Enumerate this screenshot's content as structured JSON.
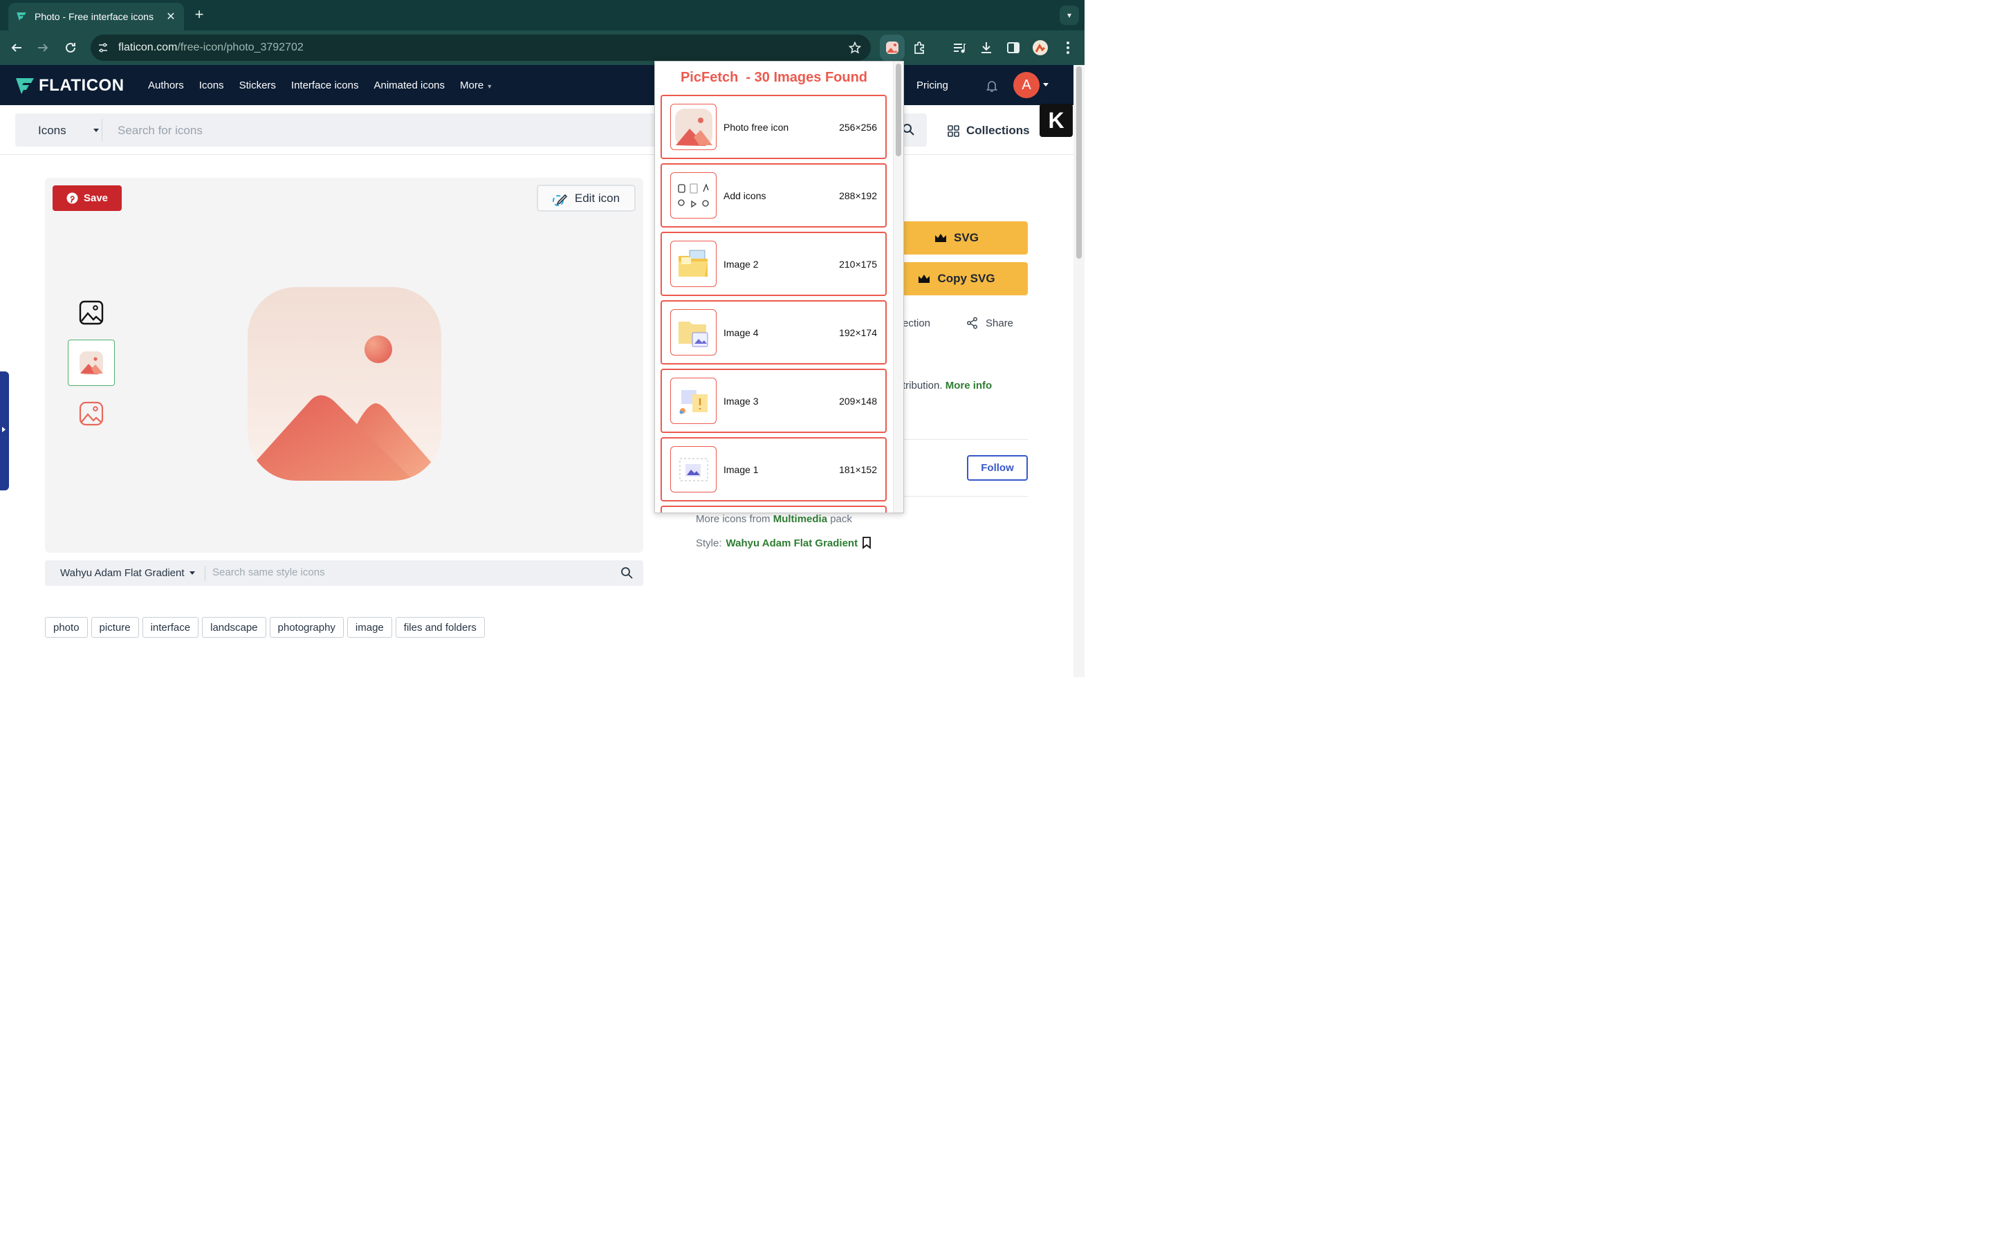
{
  "browser": {
    "tab_title": "Photo - Free interface icons",
    "url_host": "flaticon.com",
    "url_path": "/free-icon/photo_3792702"
  },
  "header": {
    "logo": "FLATICON",
    "nav": [
      "Authors",
      "Icons",
      "Stickers",
      "Interface icons",
      "Animated icons",
      "More"
    ],
    "pricing": "Pricing",
    "avatar_letter": "A"
  },
  "search": {
    "type": "Icons",
    "placeholder": "Search for icons",
    "collections": "Collections"
  },
  "preview": {
    "save_label": "Save",
    "edit_label": "Edit icon"
  },
  "style_search": {
    "style_name": "Wahyu Adam Flat Gradient",
    "placeholder": "Search same style icons"
  },
  "tags": [
    "photo",
    "picture",
    "interface",
    "landscape",
    "photography",
    "image",
    "files and folders"
  ],
  "sidebar": {
    "svg_label": "SVG",
    "copy_svg_label": "Copy SVG",
    "collection_fragment": "ection",
    "share_label": "Share",
    "attribution_text": "tribution.",
    "more_info": "More info",
    "follow_label": "Follow",
    "more_icons_prefix": "More icons from",
    "pack_name": "Multimedia",
    "pack_suffix": "pack",
    "style_prefix": "Style:",
    "style_name": "Wahyu Adam Flat Gradient"
  },
  "picfetch": {
    "title": "PicFetch  - 30 Images Found",
    "items": [
      {
        "name": "Photo free icon",
        "size": "256×256"
      },
      {
        "name": "Add icons",
        "size": "288×192"
      },
      {
        "name": "Image 2",
        "size": "210×175"
      },
      {
        "name": "Image 4",
        "size": "192×174"
      },
      {
        "name": "Image 3",
        "size": "209×148"
      },
      {
        "name": "Image 1",
        "size": "181×152"
      }
    ]
  },
  "colors": {
    "brand_navy": "#0b1c33",
    "accent_yellow": "#f5b942",
    "picfetch_red": "#ec5a4f",
    "save_red": "#c8262a",
    "link_green": "#2e7d32"
  }
}
